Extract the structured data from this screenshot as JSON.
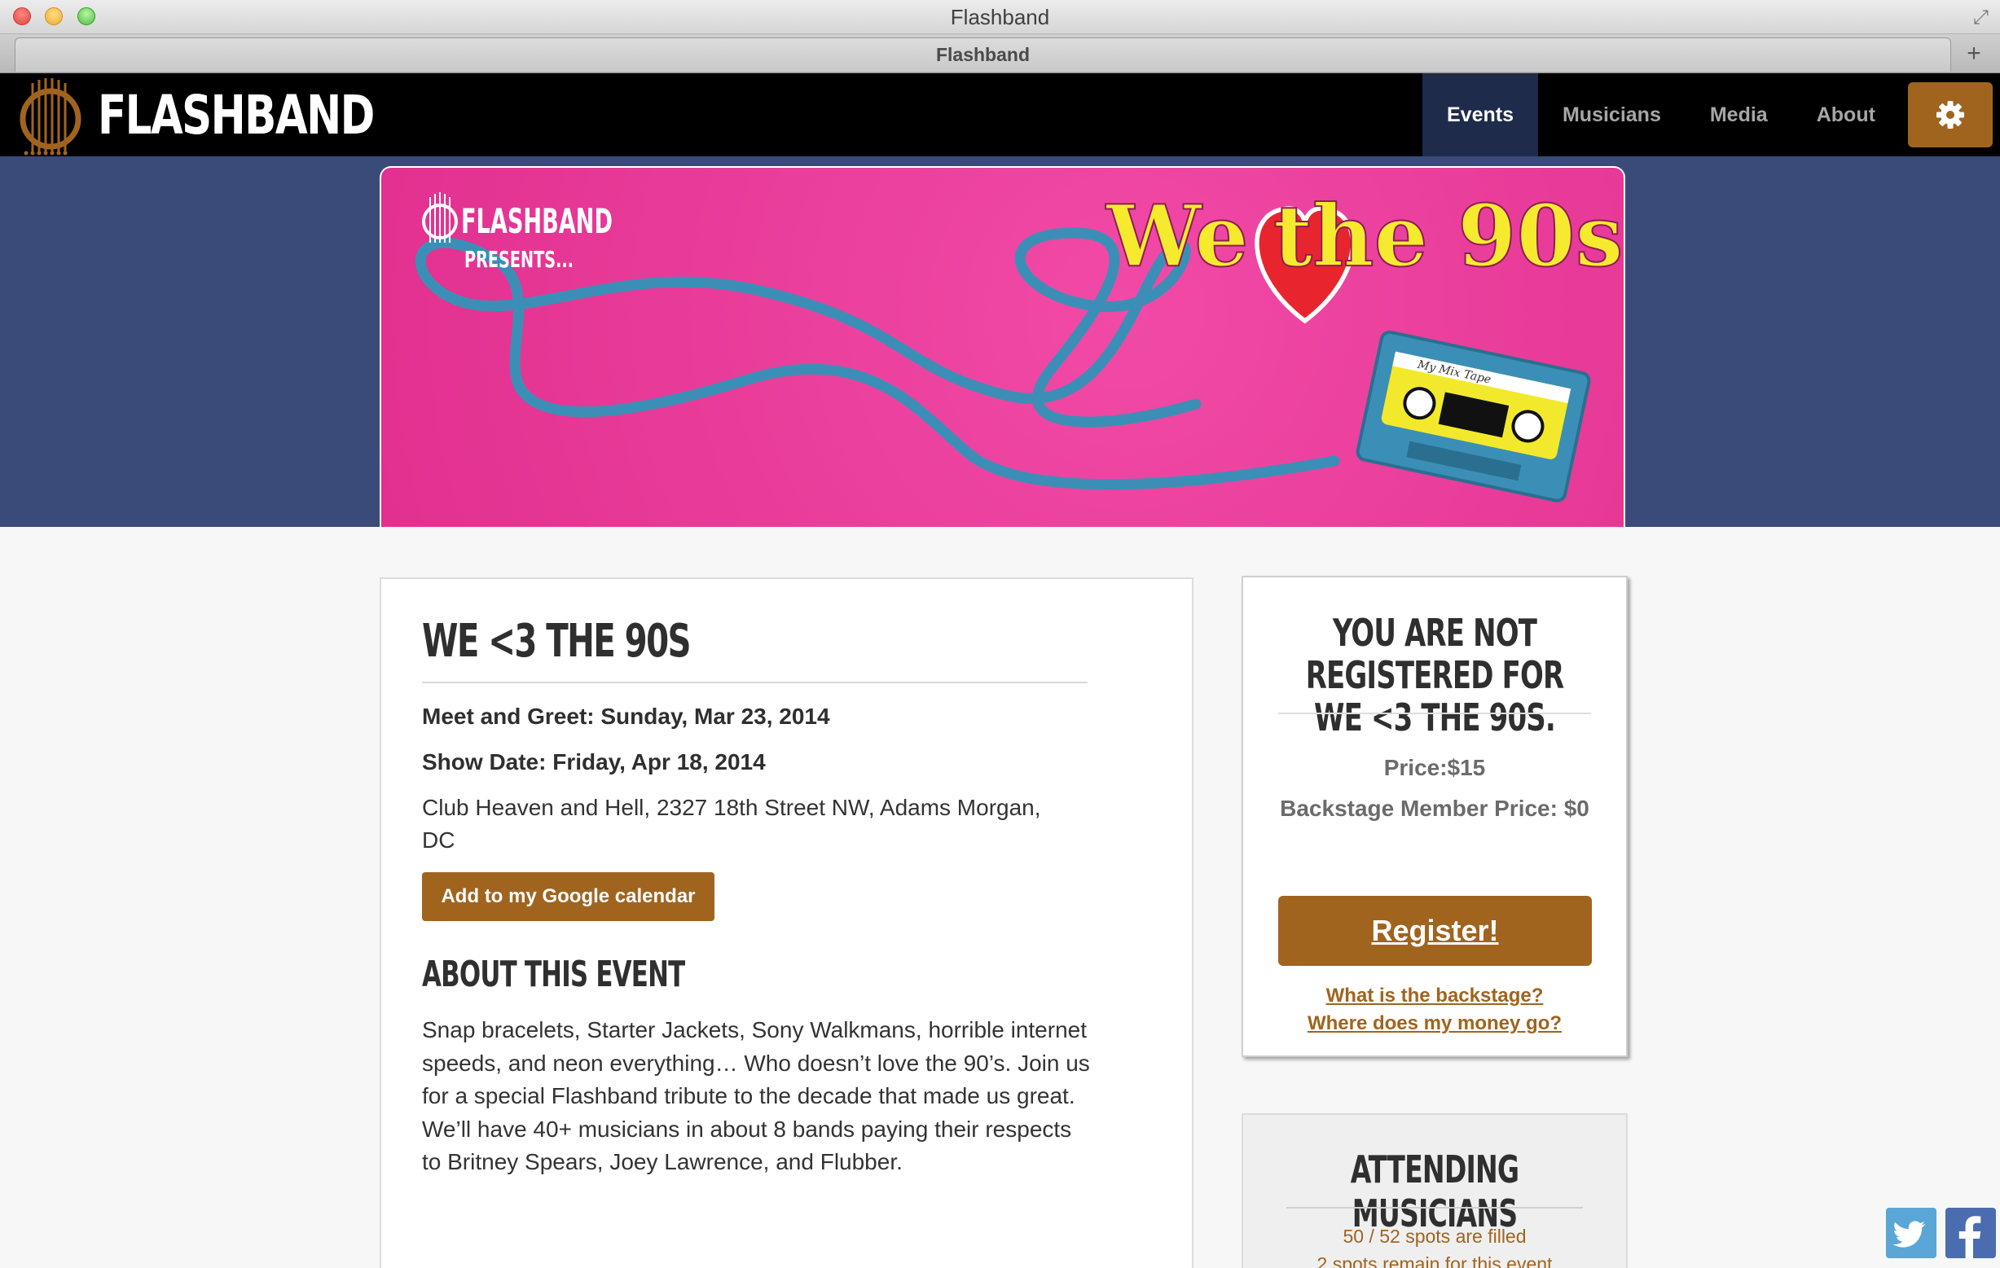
{
  "window": {
    "title": "Flashband",
    "tab_title": "Flashband",
    "fullscreen_glyph": "⤢",
    "new_tab_glyph": "+"
  },
  "nav": {
    "brand": "FLASHBAND",
    "items": [
      {
        "label": "Events",
        "active": true
      },
      {
        "label": "Musicians",
        "active": false
      },
      {
        "label": "Media",
        "active": false
      },
      {
        "label": "About",
        "active": false
      }
    ],
    "settings_icon": "gear-icon"
  },
  "banner": {
    "presenter": "FLASHBAND",
    "presents": "PRESENTS...",
    "title_we": "We",
    "title_rest": "the 90s",
    "tape_label": "My Mix Tape"
  },
  "event": {
    "title": "WE <3 THE 90S",
    "meet_and_greet": "Meet and Greet: Sunday, Mar 23, 2014",
    "show_date": "Show Date: Friday, Apr 18, 2014",
    "address": "Club Heaven and Hell, 2327 18th Street NW, Adams Morgan, DC",
    "calendar_button": "Add to my Google calendar",
    "about_heading": "ABOUT THIS EVENT",
    "about_body": "Snap bracelets, Starter Jackets, Sony Walkmans, horrible internet speeds, and neon everything… Who doesn’t love the 90’s. Join us for a special Flashband tribute to the decade that made us great. We’ll have 40+ musicians in about 8 bands paying their respects to Britney Spears, Joey Lawrence, and Flubber."
  },
  "registration": {
    "status_title": "YOU ARE NOT REGISTERED FOR WE <3 THE 90S.",
    "price": "Price:$15",
    "member_price": "Backstage Member Price: $0",
    "register_button": "Register!",
    "link_backstage": "What is the backstage?",
    "link_money": "Where does my money go?"
  },
  "musicians": {
    "heading": "ATTENDING MUSICIANS",
    "spots_filled": "50 / 52 spots are filled",
    "spots_remain": "2 spots remain for this event"
  },
  "social": {
    "twitter_icon": "twitter-icon",
    "facebook_icon": "facebook-icon"
  },
  "colors": {
    "accent": "#a0641f",
    "hero_bg": "#3a4b7a",
    "nav_bg": "#000000",
    "banner_pink": "#e2308f"
  }
}
